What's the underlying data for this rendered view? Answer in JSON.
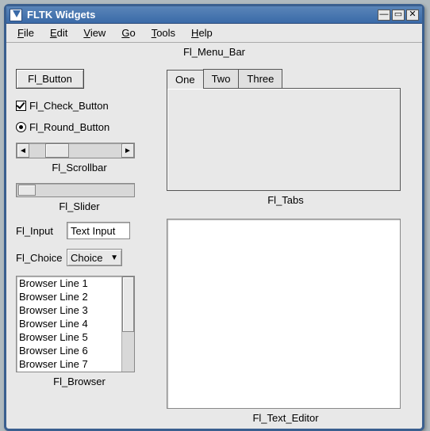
{
  "window": {
    "title": "FLTK Widgets"
  },
  "menubar": {
    "caption": "Fl_Menu_Bar",
    "items": [
      "File",
      "Edit",
      "View",
      "Go",
      "Tools",
      "Help"
    ]
  },
  "button": {
    "label": "Fl_Button"
  },
  "check": {
    "label": "Fl_Check_Button",
    "checked": true
  },
  "radio": {
    "label": "Fl_Round_Button",
    "checked": true
  },
  "scrollbar": {
    "caption": "Fl_Scrollbar"
  },
  "slider": {
    "caption": "Fl_Slider"
  },
  "input": {
    "label": "Fl_Input",
    "value": "Text Input"
  },
  "choice": {
    "label": "Fl_Choice",
    "value": "Choice"
  },
  "browser": {
    "caption": "Fl_Browser",
    "lines": [
      "Browser Line 1",
      "Browser Line 2",
      "Browser Line 3",
      "Browser Line 4",
      "Browser Line 5",
      "Browser Line 6",
      "Browser Line 7"
    ]
  },
  "tabs": {
    "caption": "Fl_Tabs",
    "items": [
      "One",
      "Two",
      "Three"
    ],
    "active": 0
  },
  "texteditor": {
    "caption": "Fl_Text_Editor"
  }
}
